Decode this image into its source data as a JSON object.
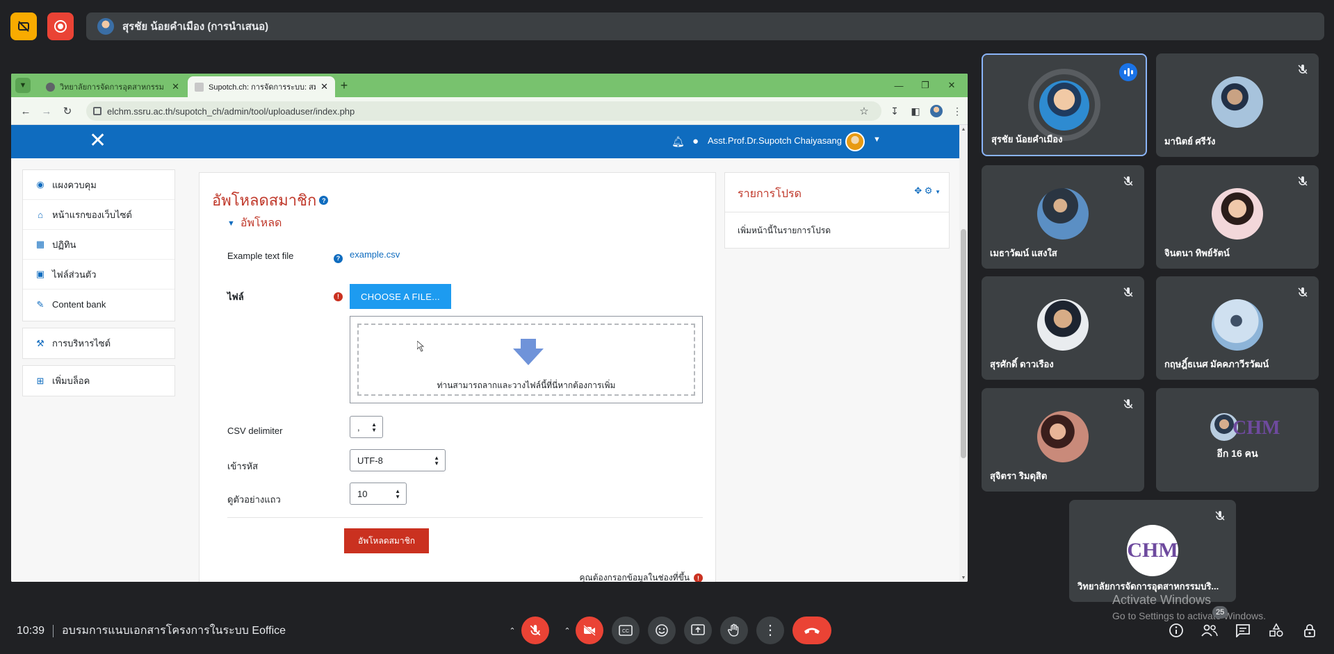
{
  "meet": {
    "presenter_label": "สุรชัย น้อยคำเมือง (การนำเสนอ)",
    "time": "10:39",
    "meeting_title": "อบรมการแนบเอกสารโครงการในระบบ Eoffice",
    "participant_badge": "25",
    "colors": {
      "background": "#202124",
      "tile": "#3c4043",
      "danger": "#ea4335",
      "accent": "#1a73e8"
    }
  },
  "browser": {
    "tabs": [
      {
        "title": "วิทยาลัยการจัดการอุตสาหกรรม และการ"
      },
      {
        "title": "Supotch.ch: การจัดการระบบ: สมาชิก"
      }
    ],
    "url": "elchm.ssru.ac.th/supotch_ch/admin/tool/uploaduser/index.php"
  },
  "moodle": {
    "user_name": "Asst.Prof.Dr.Supotch Chaiyasang",
    "nav_primary": [
      {
        "label": "แผงควบคุม",
        "icon": "dashboard-icon"
      },
      {
        "label": "หน้าแรกของเว็บไซต์",
        "icon": "home-icon"
      },
      {
        "label": "ปฏิทิน",
        "icon": "calendar-icon"
      },
      {
        "label": "ไฟล์ส่วนตัว",
        "icon": "file-icon"
      },
      {
        "label": "Content bank",
        "icon": "brush-icon"
      }
    ],
    "nav_admin": {
      "label": "การบริหารไซต์",
      "icon": "wrench-icon"
    },
    "nav_addblock": {
      "label": "เพิ่มบล็อค",
      "icon": "plus-square-icon"
    },
    "page_title": "อัพโหลดสมาชิก",
    "section_title": "อัพโหลด",
    "example_label": "Example text file",
    "example_link": "example.csv",
    "file_label": "ไฟล์",
    "choose_button": "CHOOSE A FILE...",
    "dropzone_text": "ท่านสามารถลากและวางไฟล์นี้ที่นี่หากต้องการเพิ่ม",
    "csv_label": "CSV delimiter",
    "csv_value": ",",
    "encoding_label": "เข้ารหัส",
    "encoding_value": "UTF-8",
    "preview_label": "ดูตัวอย่างแถว",
    "preview_value": "10",
    "submit_button": "อัพโหลดสมาชิก",
    "required_note": "คุณต้องกรอกข้อมูลในช่องที่ขึ้น",
    "block_title": "รายการโปรด",
    "block_item": "เพิ่มหน้านี้ในรายการโปรด",
    "colors": {
      "header": "#0f6cbf",
      "title": "#c0392b",
      "primary_button": "#1d9bf0",
      "submit": "#ca3120"
    }
  },
  "participants": [
    {
      "name": "สุรชัย น้อยคำเมือง"
    },
    {
      "name": "มานิตย์ ศรีวัง"
    },
    {
      "name": "เมธาวัฒน์ แสงใส"
    },
    {
      "name": "จินตนา ทิพย์รัตน์"
    },
    {
      "name": "สุรศักดิ์ ดาวเรือง"
    },
    {
      "name": "กฤษฎิ์ธเนศ มัคคภาวีรวัฒน์"
    },
    {
      "name": "สุจิตรา ริมดุสิต"
    },
    {
      "name": "อีก 16 คน"
    },
    {
      "name": "วิทยาลัยการจัดการอุตสาหกรรมบริ..."
    }
  ],
  "logo_text": "CHM",
  "watermark": {
    "line1": "Activate Windows",
    "line2": "Go to Settings to activate Windows."
  }
}
